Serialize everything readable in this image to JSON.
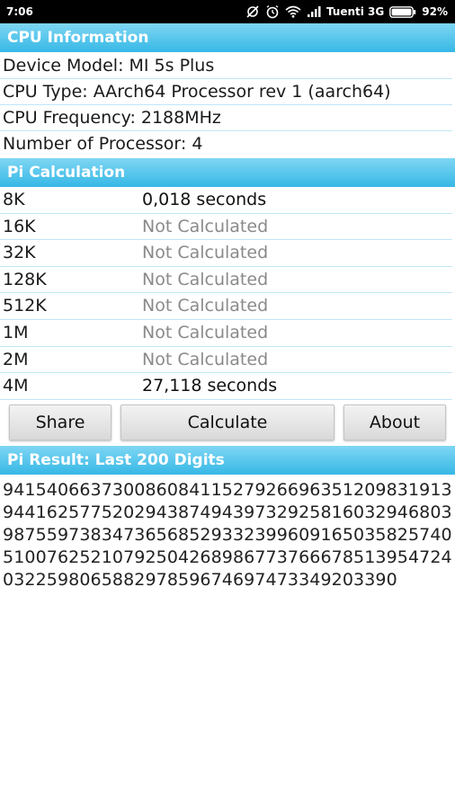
{
  "status_bar": {
    "time": "7:06",
    "carrier": "Tuenti 3G",
    "battery": "92%",
    "icons": [
      "sync-off-icon",
      "alarm-icon",
      "wifi-icon",
      "signal-icon",
      "battery-icon"
    ]
  },
  "cpu_info": {
    "title": "CPU Information",
    "device_model": "Device Model: MI 5s Plus",
    "cpu_type": "CPU Type: AArch64 Processor rev 1 (aarch64)",
    "cpu_frequency": "CPU Frequency: 2188MHz",
    "processors": "Number of Processor: 4"
  },
  "pi_calc": {
    "title": "Pi Calculation",
    "rows": [
      {
        "size": "8K",
        "value": "0,018 seconds"
      },
      {
        "size": "16K",
        "value": "Not Calculated"
      },
      {
        "size": "32K",
        "value": "Not Calculated"
      },
      {
        "size": "128K",
        "value": "Not Calculated"
      },
      {
        "size": "512K",
        "value": "Not Calculated"
      },
      {
        "size": "1M",
        "value": "Not Calculated"
      },
      {
        "size": "2M",
        "value": "Not Calculated"
      },
      {
        "size": "4M",
        "value": "27,118 seconds"
      }
    ]
  },
  "buttons": {
    "share": "Share",
    "calculate": "Calculate",
    "about": "About"
  },
  "pi_result": {
    "title": "Pi Result: Last 200 Digits",
    "digits": "94154066373008608411527926696351209831913944162577520294387494397329258160329468039875597383473656852933239960916503582574051007625210792504268986773766678513954724032259806588297859674697473349203390"
  },
  "colors": {
    "header_top": "#7fd6f3",
    "header_bottom": "#36b8e6",
    "divider": "#bfe7f5",
    "not_calculated": "#8a8a8a"
  }
}
